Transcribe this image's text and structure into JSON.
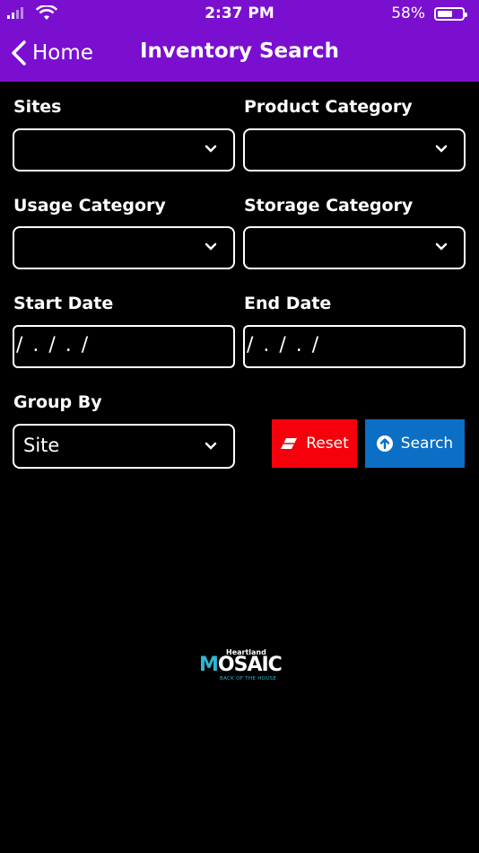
{
  "status_bar": {
    "time": "2:37 PM",
    "battery_percent": "58%",
    "battery_level": 0.58
  },
  "nav": {
    "back_label": "Home",
    "title": "Inventory Search"
  },
  "form": {
    "sites": {
      "label": "Sites",
      "value": ""
    },
    "product_category": {
      "label": "Product Category",
      "value": ""
    },
    "usage_category": {
      "label": "Usage Category",
      "value": ""
    },
    "storage_category": {
      "label": "Storage Category",
      "value": ""
    },
    "start_date": {
      "label": "Start Date",
      "value": "/ . / . /"
    },
    "end_date": {
      "label": "End Date",
      "value": "/ . / . /"
    },
    "group_by": {
      "label": "Group By",
      "value": "Site"
    }
  },
  "buttons": {
    "reset_label": "Reset",
    "search_label": "Search"
  },
  "logo": {
    "brand_top": "Heartland",
    "brand_main_initial": "M",
    "brand_main_rest": "OSAIC",
    "brand_sub": "BACK OF THE HOUSE"
  },
  "colors": {
    "header_bg": "#7a0fd0",
    "reset_bg": "#f5000b",
    "search_bg": "#0b6fc5",
    "logo_accent": "#2fb6d0"
  }
}
